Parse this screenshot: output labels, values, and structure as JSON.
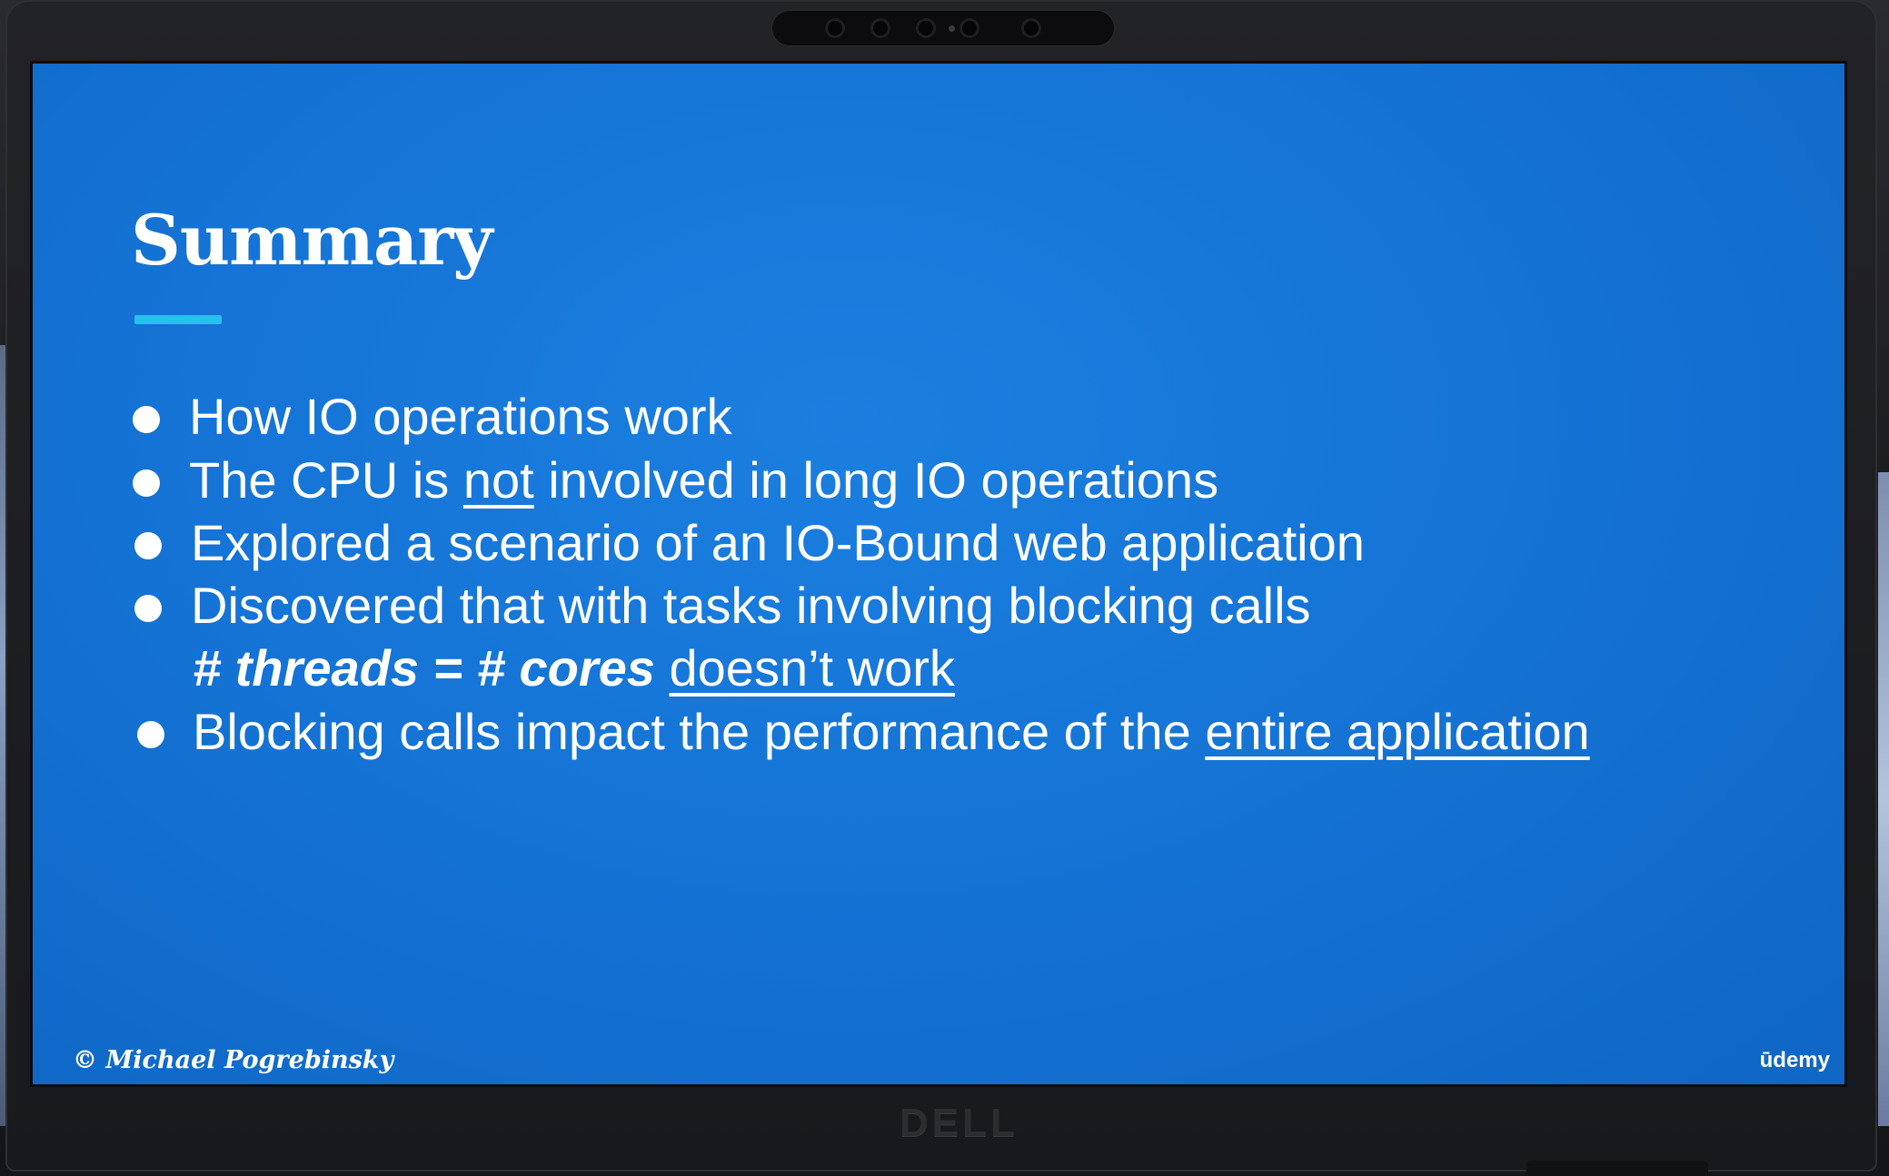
{
  "slide": {
    "title": "Summary",
    "bullets": [
      {
        "parts": [
          {
            "text": "How IO operations work"
          }
        ]
      },
      {
        "parts": [
          {
            "text": "The CPU is "
          },
          {
            "text": "not",
            "style": "underline"
          },
          {
            "text": " involved in long IO operations"
          }
        ]
      },
      {
        "parts": [
          {
            "text": "Explored a scenario of an IO-Bound web application"
          }
        ]
      },
      {
        "parts": [
          {
            "text": "Discovered that with tasks involving blocking calls"
          }
        ]
      },
      {
        "parts": [
          {
            "text": "# threads = # cores",
            "style": "bold-italic"
          },
          {
            "text": " "
          },
          {
            "text": "doesn’t work",
            "style": "underline"
          }
        ],
        "continuation": true
      },
      {
        "parts": [
          {
            "text": "Blocking calls impact the performance of the "
          },
          {
            "text": "entire application",
            "style": "underline"
          }
        ]
      }
    ],
    "footer_left": "© Michael Pogrebinsky",
    "footer_right": "ūdemy"
  },
  "device": {
    "brand": "DELL"
  },
  "colors": {
    "slide_background": "#1574d6",
    "title_rule": "#22c3ee",
    "text": "#ffffff"
  }
}
